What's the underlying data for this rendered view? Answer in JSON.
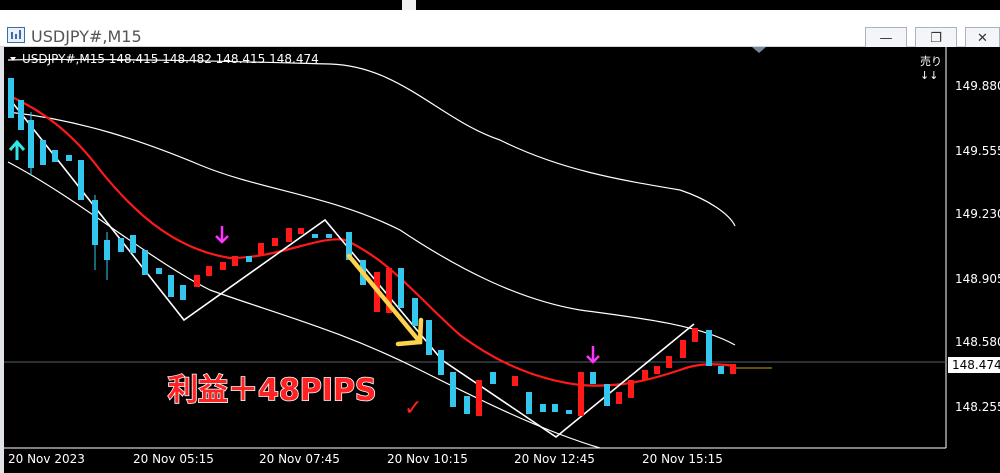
{
  "window": {
    "title": "USDJPY#,M15",
    "minimize": "—",
    "restore": "❐",
    "close": "✕"
  },
  "chart_info": {
    "header": "USDJPY#,M15  148.415 148.482 148.415 148.474",
    "expert_label": "売り",
    "expert_arrows": "↓↓",
    "current_price": "148.474"
  },
  "price_axis": [
    "149.880",
    "149.555",
    "149.230",
    "148.905",
    "148.580",
    "148.255"
  ],
  "time_axis": [
    "20 Nov 2023",
    "20 Nov 05:15",
    "20 Nov 07:45",
    "20 Nov 10:15",
    "20 Nov 12:45",
    "20 Nov 15:15"
  ],
  "annotation": {
    "text": "利益＋48PIPS",
    "check": "✓"
  },
  "colors": {
    "bull": "#ff1a1a",
    "bear": "#33c7ee",
    "ma": "#ff1a1a",
    "band": "#ffffff",
    "zigzag": "#ffffff",
    "signal_arrow": "#ff33ff",
    "buy_arrow": "#33e6e6",
    "trend_arrow": "#ffd24d"
  }
}
